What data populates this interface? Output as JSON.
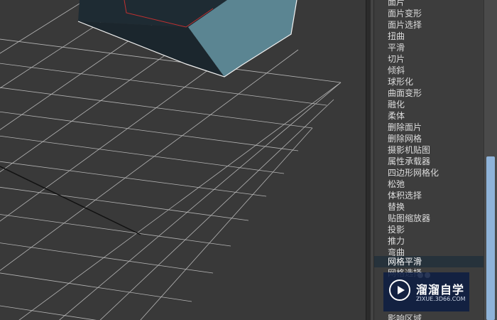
{
  "modifier_list": {
    "items": [
      {
        "label": "面片"
      },
      {
        "label": "面片变形"
      },
      {
        "label": "面片选择"
      },
      {
        "label": "扭曲"
      },
      {
        "label": "平滑"
      },
      {
        "label": "切片"
      },
      {
        "label": "倾斜"
      },
      {
        "label": "球形化"
      },
      {
        "label": "曲面变形"
      },
      {
        "label": "融化"
      },
      {
        "label": "柔体"
      },
      {
        "label": "删除面片"
      },
      {
        "label": "删除网格"
      },
      {
        "label": "摄影机贴图"
      },
      {
        "label": "属性承载器"
      },
      {
        "label": "四边形网格化"
      },
      {
        "label": "松弛"
      },
      {
        "label": "体积选择"
      },
      {
        "label": "替换"
      },
      {
        "label": "贴图缩放器"
      },
      {
        "label": "投影"
      },
      {
        "label": "推力"
      },
      {
        "label": "弯曲"
      },
      {
        "label": "网格平滑",
        "selected": true
      },
      {
        "label": "网格选择"
      },
      {
        "label": ""
      },
      {
        "label": ""
      },
      {
        "label": "影响区域"
      }
    ]
  },
  "watermark": {
    "title": "溜溜自学",
    "url": "ZIXUE.3D66.COM"
  },
  "colors": {
    "viewport_bg": "#393939",
    "grid": "#b5b5b5",
    "box_top": "#1e2b33",
    "box_side": "#5b8592",
    "selection": "#26323b",
    "watermark_bg": "#0e1e42"
  }
}
